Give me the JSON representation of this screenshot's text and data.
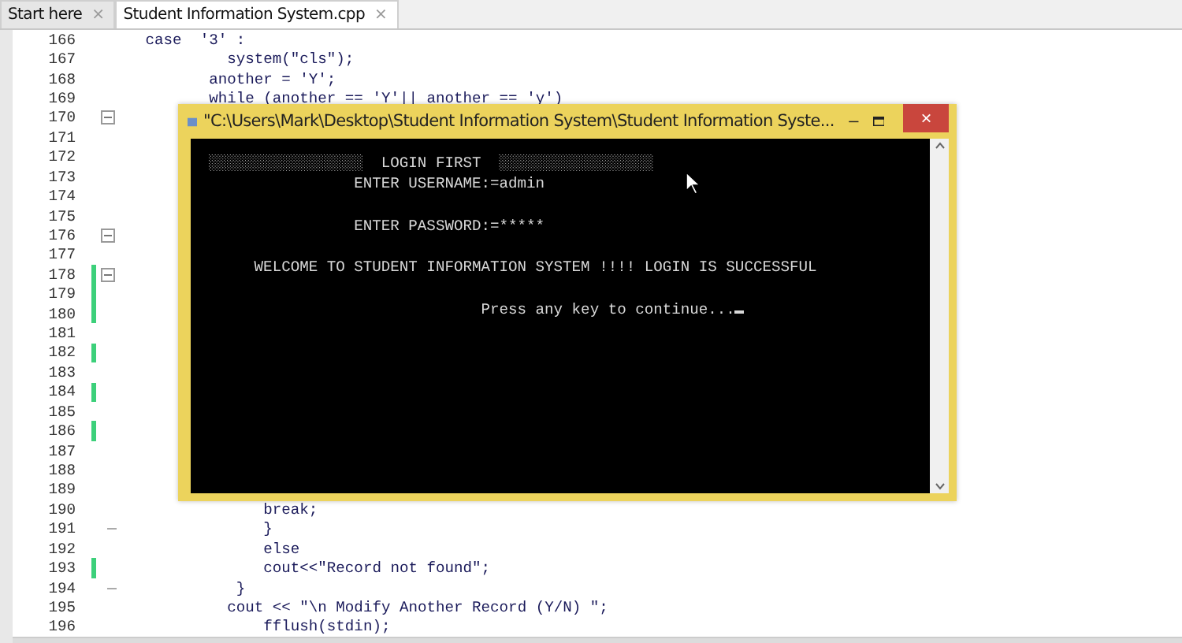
{
  "tabs": [
    {
      "label": "Start here",
      "close": "×",
      "selected": false
    },
    {
      "label": "Student Information System.cpp",
      "close": "×",
      "selected": true
    }
  ],
  "editor": {
    "lines": [
      {
        "number": "166",
        "code": "   case  '3' :",
        "changed": false,
        "fold_open": false,
        "fold_end": false
      },
      {
        "number": "167",
        "code": "            system(\"cls\");",
        "changed": false,
        "fold_open": false,
        "fold_end": false
      },
      {
        "number": "168",
        "code": "          another = 'Y';",
        "changed": false,
        "fold_open": false,
        "fold_end": false
      },
      {
        "number": "169",
        "code": "          while (another == 'Y'|| another == 'y')",
        "changed": false,
        "fold_open": false,
        "fold_end": false
      },
      {
        "number": "170",
        "changed": false,
        "fold_open": true,
        "fold_end": false
      },
      {
        "number": "171",
        "changed": false,
        "fold_open": false,
        "fold_end": false
      },
      {
        "number": "172",
        "changed": false,
        "fold_open": false,
        "fold_end": false
      },
      {
        "number": "173",
        "changed": false,
        "fold_open": false,
        "fold_end": false
      },
      {
        "number": "174",
        "changed": false,
        "fold_open": false,
        "fold_end": false
      },
      {
        "number": "175",
        "changed": false,
        "fold_open": false,
        "fold_end": false
      },
      {
        "number": "176",
        "changed": false,
        "fold_open": true,
        "fold_end": false
      },
      {
        "number": "177",
        "changed": false,
        "fold_open": false,
        "fold_end": false
      },
      {
        "number": "178",
        "changed": true,
        "fold_open": true,
        "fold_end": false
      },
      {
        "number": "179",
        "changed": true,
        "fold_open": false,
        "fold_end": false
      },
      {
        "number": "180",
        "changed": true,
        "fold_open": false,
        "fold_end": false
      },
      {
        "number": "181",
        "changed": false,
        "fold_open": false,
        "fold_end": false
      },
      {
        "number": "182",
        "changed": true,
        "fold_open": false,
        "fold_end": false
      },
      {
        "number": "183",
        "changed": false,
        "fold_open": false,
        "fold_end": false
      },
      {
        "number": "184",
        "changed": true,
        "fold_open": false,
        "fold_end": false
      },
      {
        "number": "185",
        "changed": false,
        "fold_open": false,
        "fold_end": false
      },
      {
        "number": "186",
        "changed": true,
        "fold_open": false,
        "fold_end": false
      },
      {
        "number": "187",
        "changed": false,
        "fold_open": false,
        "fold_end": false
      },
      {
        "number": "188",
        "changed": false,
        "fold_open": false,
        "fold_end": false
      },
      {
        "number": "189",
        "changed": false,
        "fold_open": false,
        "fold_end": false
      },
      {
        "number": "190",
        "code": "                break;",
        "changed": false,
        "fold_open": false,
        "fold_end": false
      },
      {
        "number": "191",
        "code": "                }",
        "changed": false,
        "fold_open": false,
        "fold_end": true
      },
      {
        "number": "192",
        "code": "                else",
        "changed": false,
        "fold_open": false,
        "fold_end": false
      },
      {
        "number": "193",
        "code": "                cout<<\"Record not found\";",
        "changed": true,
        "fold_open": false,
        "fold_end": false
      },
      {
        "number": "194",
        "code": "             }",
        "changed": false,
        "fold_open": false,
        "fold_end": true
      },
      {
        "number": "195",
        "code": "            cout << \"\\n Modify Another Record (Y/N) \";",
        "changed": false,
        "fold_open": false,
        "fold_end": false
      },
      {
        "number": "196",
        "code": "                fflush(stdin);",
        "changed": false,
        "fold_open": false,
        "fold_end": false
      }
    ]
  },
  "console": {
    "title": "\"C:\\Users\\Mark\\Desktop\\Student Information System\\Student Information Syste...",
    "minimize": "–",
    "close": "×",
    "output": "  ░░░░░░░░░░░░░░░░░  LOGIN FIRST  ░░░░░░░░░░░░░░░░░\n                  ENTER USERNAME:=admin\n\n                  ENTER PASSWORD:=*****\n\n       WELCOME TO STUDENT INFORMATION SYSTEM !!!! LOGIN IS SUCCESSFUL\n\n                                Press any key to continue..."
  }
}
